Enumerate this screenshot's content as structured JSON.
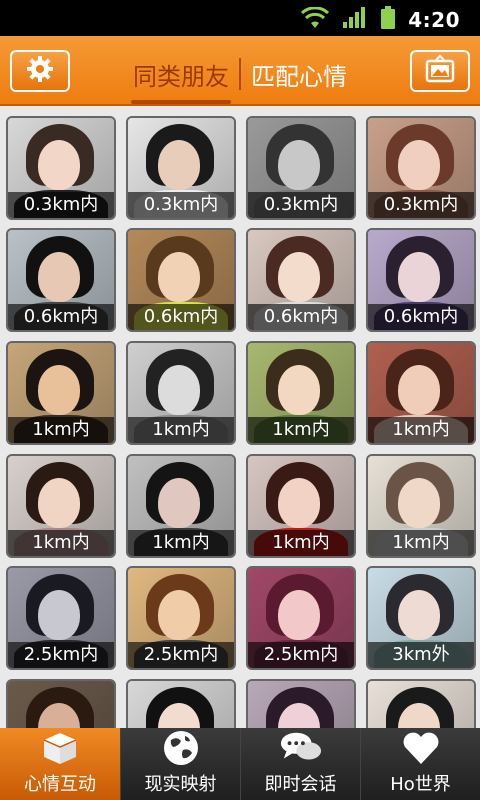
{
  "status_bar": {
    "time": "4:20",
    "icons": [
      "wifi-icon",
      "signal-icon",
      "battery-icon"
    ]
  },
  "header": {
    "left_button_icon": "gear-icon",
    "right_button_icon": "picture-frame-icon",
    "tabs": [
      {
        "label": "同类朋友",
        "active": true
      },
      {
        "label": "匹配心情",
        "active": false
      }
    ]
  },
  "grid": {
    "rows": [
      [
        "0.3km内",
        "0.3km内",
        "0.3km内",
        "0.3km内"
      ],
      [
        "0.6km内",
        "0.6km内",
        "0.6km内",
        "0.6km内"
      ],
      [
        "1km内",
        "1km内",
        "1km内",
        "1km内"
      ],
      [
        "1km内",
        "1km内",
        "1km内",
        "1km内"
      ],
      [
        "2.5km内",
        "2.5km内",
        "2.5km内",
        "3km外"
      ],
      [
        "",
        "",
        "",
        ""
      ]
    ]
  },
  "bottom_nav": [
    {
      "label": "心情互动",
      "icon": "box-icon",
      "active": true
    },
    {
      "label": "现实映射",
      "icon": "globe-icon",
      "active": false
    },
    {
      "label": "即时会话",
      "icon": "chat-bubbles-icon",
      "active": false
    },
    {
      "label": "Ho世界",
      "icon": "heart-icon",
      "active": false
    }
  ],
  "colors": {
    "accent": "#ef7d0f",
    "tab_active": "#9b3a00",
    "nav_bg": "#2a2a2a"
  }
}
